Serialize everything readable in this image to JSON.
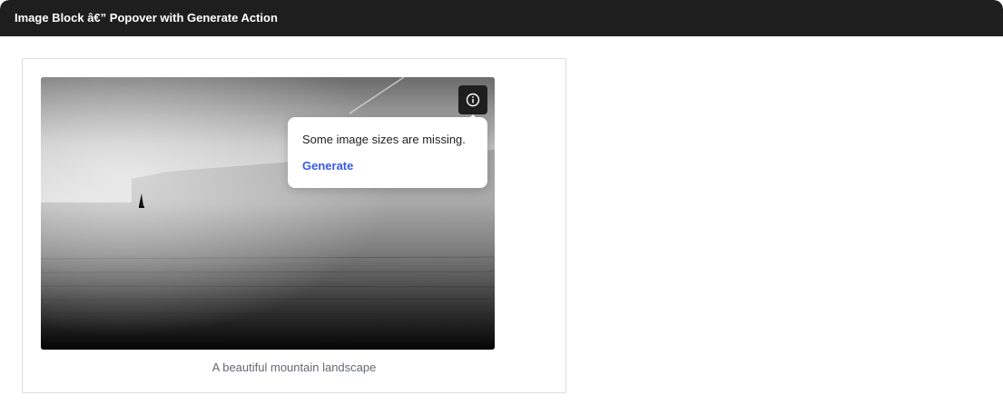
{
  "window": {
    "title": "Image Block â€” Popover with Generate Action"
  },
  "image_block": {
    "image_alt": "Grayscale lake with a small sailboat and misty mountains",
    "caption": "A beautiful mountain landscape",
    "info_icon": "info-icon"
  },
  "popover": {
    "message": "Some image sizes are missing.",
    "action_label": "Generate",
    "action_color": "#3858e9"
  }
}
